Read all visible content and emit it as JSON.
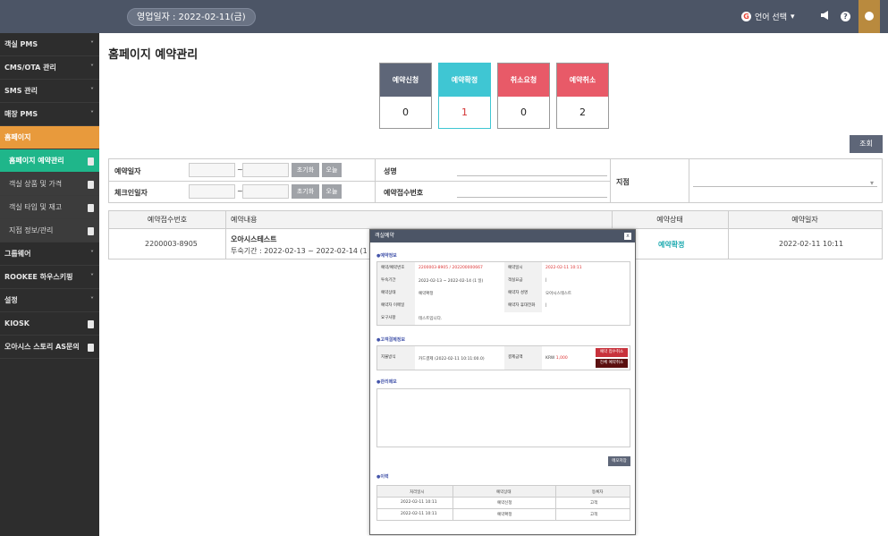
{
  "topbar": {
    "business_date": "영업일자 : 2022-02-11(금)",
    "language": "언어 선택",
    "language_arrow": "▾",
    "megaphone_icon": "megaphone-icon",
    "help_label": "?",
    "user_icon": "user-icon"
  },
  "sidebar": {
    "items": [
      {
        "label": "객실 PMS",
        "marker": "chevron"
      },
      {
        "label": "CMS/OTA 관리",
        "marker": "chevron"
      },
      {
        "label": "SMS 관리",
        "marker": "chevron"
      },
      {
        "label": "매장 PMS",
        "marker": "chevron"
      },
      {
        "label": "홈페이지",
        "marker": "none"
      },
      {
        "label": "홈페이지 예약관리",
        "marker": "doc"
      },
      {
        "label": "객실 상품 및 가격",
        "marker": "doc"
      },
      {
        "label": "객실 타입 및 재고",
        "marker": "doc"
      },
      {
        "label": "지점 정보/관리",
        "marker": "doc"
      },
      {
        "label": "그룹웨어",
        "marker": "chevron"
      },
      {
        "label": "ROOKEE 하우스키핑",
        "marker": "chevron"
      },
      {
        "label": "설정",
        "marker": "chevron"
      },
      {
        "label": "KIOSK",
        "marker": "doc"
      },
      {
        "label": "오아시스 스토리 AS문의",
        "marker": "doc"
      }
    ],
    "chevron": "˅"
  },
  "page": {
    "title": "홈페이지 예약관리",
    "search_button": "조회"
  },
  "stats": [
    {
      "label": "예약신청",
      "value": "0",
      "color": "#5e6678",
      "value_color": "#222222"
    },
    {
      "label": "예약확정",
      "value": "1",
      "color": "#3fc6d3",
      "value_color": "#d33333"
    },
    {
      "label": "취소요청",
      "value": "0",
      "color": "#e85a68",
      "value_color": "#222222"
    },
    {
      "label": "예약취소",
      "value": "2",
      "color": "#e85a68",
      "value_color": "#222222"
    }
  ],
  "filter": {
    "reservation_date_label": "예약일자",
    "checkin_date_label": "체크인일자",
    "tilde": "~",
    "reset_button": "초기화",
    "today_button": "오늘",
    "name_label": "성명",
    "reception_no_label": "예약접수번호",
    "branch_label": "지점"
  },
  "table": {
    "headers": [
      "예약접수번호",
      "예약내용",
      "예약상태",
      "예약일자"
    ],
    "rows": [
      {
        "reception_no": "2200003-8905",
        "title": "오아시스테스트",
        "period": "투숙기간 : 2022-02-13 ~ 2022-02-14 (1 일)",
        "status": "예약확정",
        "date": "2022-02-11 10:11"
      }
    ]
  },
  "modal": {
    "title": "객실예약",
    "close": "x",
    "sec_reservation": "●예약정보",
    "res": {
      "no_label": "예약/예약번호",
      "no_value": "2200003-8905 / 202200000667",
      "date_label": "예약일시",
      "date_value": "2022-02-11 10:11",
      "stay_label": "투숙기간",
      "stay_value": "2022-02-13 ~ 2022-02-14 (1 일)",
      "room_label": "객실요금",
      "room_value": "|",
      "status_label": "예약상태",
      "status_value": "예약확정",
      "guest_label": "예약자 성명",
      "guest_value": "오아시스테스트",
      "email_label": "예약자 이메일",
      "email_value": "",
      "phone_label": "예약자 휴대전화",
      "phone_value": "|",
      "req_label": "요구사항",
      "req_value": "테스트입니다."
    },
    "sec_payment": "●고객결제정보",
    "pay": {
      "method_label": "지불방식",
      "method_value": "카드결제 (2022-02-11 10:11:00.0)",
      "amount_label": "결제금액",
      "currency": "KRW",
      "amount_value": "1,000",
      "confirm_cancel_btn": "예약 접수취소",
      "full_cancel_btn": "전체 예약취소"
    },
    "sec_memo": "●관리메모",
    "memo_save": "메모저장",
    "sec_history": "●이력",
    "history_headers": [
      "처리일시",
      "예약상태",
      "등록자"
    ],
    "history_rows": [
      [
        "2022-02-11 10:11",
        "예약신청",
        "고객"
      ],
      [
        "2022-02-11 10:11",
        "예약확정",
        "고객"
      ]
    ]
  }
}
